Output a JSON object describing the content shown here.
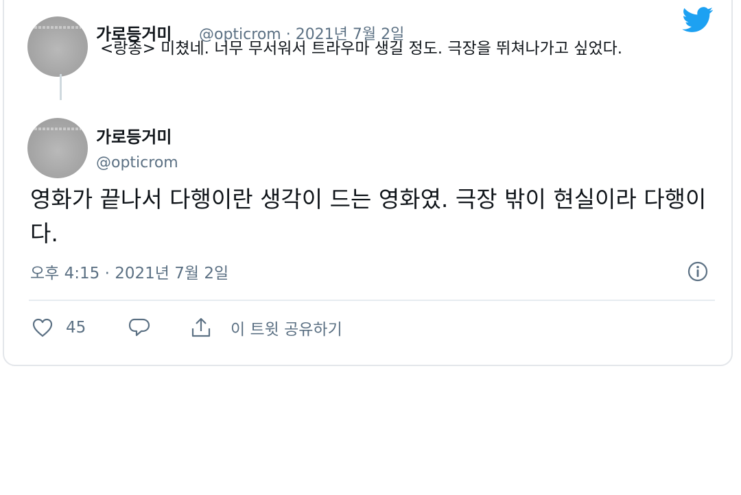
{
  "reply_tweet": {
    "name": "가로등거미",
    "handle_date": "@opticrom · 2021년 7월 2일",
    "text": "<랑종> 미쳤네. 너무 무서워서 트라우마 생길 정도. 극장을 뛰쳐나가고 싶었다."
  },
  "main_tweet": {
    "name": "가로등거미",
    "handle": "@opticrom",
    "text": "영화가 끝나서 다행이란 생각이 드는 영화였. 극장 밖이 현실이라 다행이다.",
    "timestamp": "오후 4:15 · 2021년 7월 2일"
  },
  "actions": {
    "like_count": "45",
    "share_label": "이 트윗 공유하기"
  },
  "icons": {
    "brand": "twitter-bird-icon",
    "info": "info-icon",
    "like": "heart-icon",
    "reply": "comment-icon",
    "share": "share-icon"
  },
  "colors": {
    "brand_blue": "#1da1f2",
    "text_primary": "#0f1419",
    "text_secondary": "#5b7083",
    "border": "#e3e6ea"
  }
}
